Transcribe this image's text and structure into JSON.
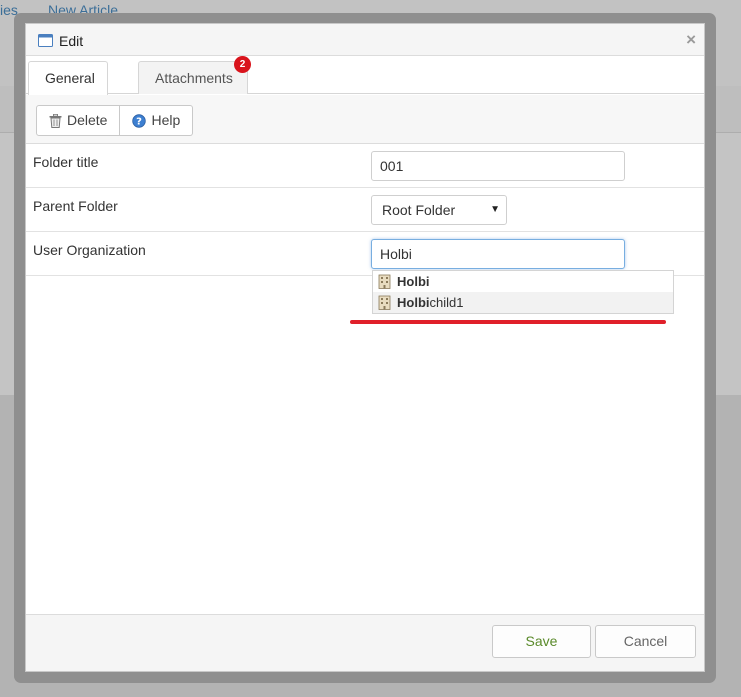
{
  "background": {
    "link_left": "ies",
    "link_new_article": "New Article"
  },
  "dialog": {
    "title": "Edit",
    "close_glyph": "×",
    "tabs": [
      {
        "label": "General",
        "active": true
      },
      {
        "label": "Attachments",
        "badge": "2"
      }
    ],
    "toolbar": {
      "delete_label": "Delete",
      "help_label": "Help"
    },
    "fields": {
      "folder_title": {
        "label": "Folder title",
        "value": "001"
      },
      "parent_folder": {
        "label": "Parent Folder",
        "value": "Root Folder"
      },
      "user_organization": {
        "label": "User Organization",
        "value": "Holbi"
      }
    },
    "autocomplete": [
      {
        "match": "Holbi",
        "rest": ""
      },
      {
        "match": "Holbi",
        "rest": "child1"
      }
    ],
    "footer": {
      "save_label": "Save",
      "cancel_label": "Cancel"
    }
  },
  "colors": {
    "badge": "#d9141c",
    "annotation_line": "#e0202a",
    "save_text": "#5a8a2a",
    "link": "#3b6e98"
  },
  "icons": {
    "window": "window-icon",
    "close": "close-icon",
    "delete": "trash-icon",
    "help": "help-icon",
    "organization": "building-icon",
    "dropdown": "caret-down-icon"
  }
}
